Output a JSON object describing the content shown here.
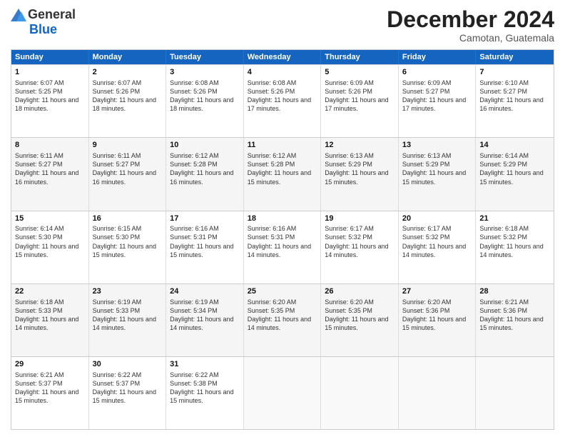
{
  "logo": {
    "general": "General",
    "blue": "Blue"
  },
  "title": {
    "month": "December 2024",
    "location": "Camotan, Guatemala"
  },
  "weekdays": [
    "Sunday",
    "Monday",
    "Tuesday",
    "Wednesday",
    "Thursday",
    "Friday",
    "Saturday"
  ],
  "weeks": [
    [
      {
        "day": "1",
        "sunrise": "6:07 AM",
        "sunset": "5:25 PM",
        "daylight": "11 hours and 18 minutes."
      },
      {
        "day": "2",
        "sunrise": "6:07 AM",
        "sunset": "5:26 PM",
        "daylight": "11 hours and 18 minutes."
      },
      {
        "day": "3",
        "sunrise": "6:08 AM",
        "sunset": "5:26 PM",
        "daylight": "11 hours and 18 minutes."
      },
      {
        "day": "4",
        "sunrise": "6:08 AM",
        "sunset": "5:26 PM",
        "daylight": "11 hours and 17 minutes."
      },
      {
        "day": "5",
        "sunrise": "6:09 AM",
        "sunset": "5:26 PM",
        "daylight": "11 hours and 17 minutes."
      },
      {
        "day": "6",
        "sunrise": "6:09 AM",
        "sunset": "5:27 PM",
        "daylight": "11 hours and 17 minutes."
      },
      {
        "day": "7",
        "sunrise": "6:10 AM",
        "sunset": "5:27 PM",
        "daylight": "11 hours and 16 minutes."
      }
    ],
    [
      {
        "day": "8",
        "sunrise": "6:11 AM",
        "sunset": "5:27 PM",
        "daylight": "11 hours and 16 minutes."
      },
      {
        "day": "9",
        "sunrise": "6:11 AM",
        "sunset": "5:27 PM",
        "daylight": "11 hours and 16 minutes."
      },
      {
        "day": "10",
        "sunrise": "6:12 AM",
        "sunset": "5:28 PM",
        "daylight": "11 hours and 16 minutes."
      },
      {
        "day": "11",
        "sunrise": "6:12 AM",
        "sunset": "5:28 PM",
        "daylight": "11 hours and 15 minutes."
      },
      {
        "day": "12",
        "sunrise": "6:13 AM",
        "sunset": "5:29 PM",
        "daylight": "11 hours and 15 minutes."
      },
      {
        "day": "13",
        "sunrise": "6:13 AM",
        "sunset": "5:29 PM",
        "daylight": "11 hours and 15 minutes."
      },
      {
        "day": "14",
        "sunrise": "6:14 AM",
        "sunset": "5:29 PM",
        "daylight": "11 hours and 15 minutes."
      }
    ],
    [
      {
        "day": "15",
        "sunrise": "6:14 AM",
        "sunset": "5:30 PM",
        "daylight": "11 hours and 15 minutes."
      },
      {
        "day": "16",
        "sunrise": "6:15 AM",
        "sunset": "5:30 PM",
        "daylight": "11 hours and 15 minutes."
      },
      {
        "day": "17",
        "sunrise": "6:16 AM",
        "sunset": "5:31 PM",
        "daylight": "11 hours and 15 minutes."
      },
      {
        "day": "18",
        "sunrise": "6:16 AM",
        "sunset": "5:31 PM",
        "daylight": "11 hours and 14 minutes."
      },
      {
        "day": "19",
        "sunrise": "6:17 AM",
        "sunset": "5:32 PM",
        "daylight": "11 hours and 14 minutes."
      },
      {
        "day": "20",
        "sunrise": "6:17 AM",
        "sunset": "5:32 PM",
        "daylight": "11 hours and 14 minutes."
      },
      {
        "day": "21",
        "sunrise": "6:18 AM",
        "sunset": "5:32 PM",
        "daylight": "11 hours and 14 minutes."
      }
    ],
    [
      {
        "day": "22",
        "sunrise": "6:18 AM",
        "sunset": "5:33 PM",
        "daylight": "11 hours and 14 minutes."
      },
      {
        "day": "23",
        "sunrise": "6:19 AM",
        "sunset": "5:33 PM",
        "daylight": "11 hours and 14 minutes."
      },
      {
        "day": "24",
        "sunrise": "6:19 AM",
        "sunset": "5:34 PM",
        "daylight": "11 hours and 14 minutes."
      },
      {
        "day": "25",
        "sunrise": "6:20 AM",
        "sunset": "5:35 PM",
        "daylight": "11 hours and 14 minutes."
      },
      {
        "day": "26",
        "sunrise": "6:20 AM",
        "sunset": "5:35 PM",
        "daylight": "11 hours and 15 minutes."
      },
      {
        "day": "27",
        "sunrise": "6:20 AM",
        "sunset": "5:36 PM",
        "daylight": "11 hours and 15 minutes."
      },
      {
        "day": "28",
        "sunrise": "6:21 AM",
        "sunset": "5:36 PM",
        "daylight": "11 hours and 15 minutes."
      }
    ],
    [
      {
        "day": "29",
        "sunrise": "6:21 AM",
        "sunset": "5:37 PM",
        "daylight": "11 hours and 15 minutes."
      },
      {
        "day": "30",
        "sunrise": "6:22 AM",
        "sunset": "5:37 PM",
        "daylight": "11 hours and 15 minutes."
      },
      {
        "day": "31",
        "sunrise": "6:22 AM",
        "sunset": "5:38 PM",
        "daylight": "11 hours and 15 minutes."
      },
      null,
      null,
      null,
      null
    ]
  ]
}
